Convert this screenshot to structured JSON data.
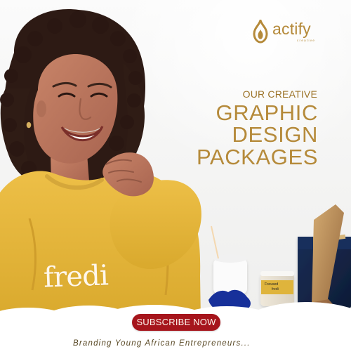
{
  "brand": {
    "name": "actify",
    "subname": "creative",
    "logo_icon": "flame-icon"
  },
  "hero": {
    "kicker": "OUR CREATIVE",
    "lines": [
      "GRAPHIC",
      "DESIGN",
      "PACKAGES"
    ]
  },
  "visuals": {
    "sweater_text": "fredi",
    "jar_title": "Focused",
    "jar_brand": "fredi"
  },
  "cta": {
    "button_label": "SUBSCRIBE NOW"
  },
  "footer": {
    "tagline": "Branding Young African Entrepreneurs..."
  },
  "colors": {
    "gold": "#b58a3a",
    "gold_dark": "#9c7328",
    "red": "#a6151c",
    "yellow": "#e5b53b",
    "navy": "#132444",
    "skin": "#b5765d",
    "hair": "#2d1a14",
    "cloud": "#ffffff"
  }
}
